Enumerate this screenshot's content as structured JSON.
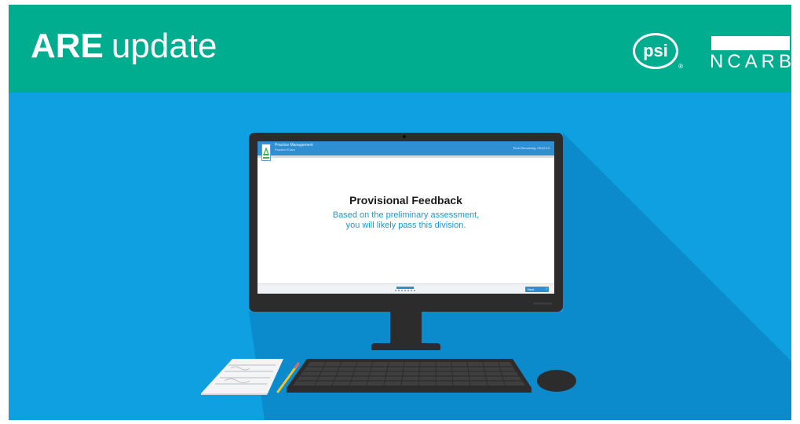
{
  "header": {
    "brand_bold": "ARE",
    "brand_light": "update",
    "logos": {
      "psi": "psi",
      "psi_registered": "®",
      "ncarb": "NCARB"
    },
    "background_color": "#00ad8e"
  },
  "scene": {
    "background_color": "#0ea0e0",
    "shadow_color": "#0b8bcb"
  },
  "exam_screen": {
    "header_exam": "Practice Management",
    "header_sub": "Practice Exam",
    "header_time": "Time Remaining: 03:02:13",
    "feedback_title": "Provisional Feedback",
    "feedback_line1": "Based on the preliminary assessment,",
    "feedback_line2": "you will likely pass this division.",
    "next_label": "Next",
    "next_icon": "chevron-right-icon",
    "accent_color": "#2f8fd3",
    "message_color": "#1a9ad6"
  },
  "props": {
    "logo_icon": "ncarb-triangle-icon",
    "keyboard_icon": "keyboard-icon",
    "mouse_icon": "mouse-icon",
    "notepad_icon": "notepad-icon",
    "pencil_icon": "pencil-icon"
  }
}
